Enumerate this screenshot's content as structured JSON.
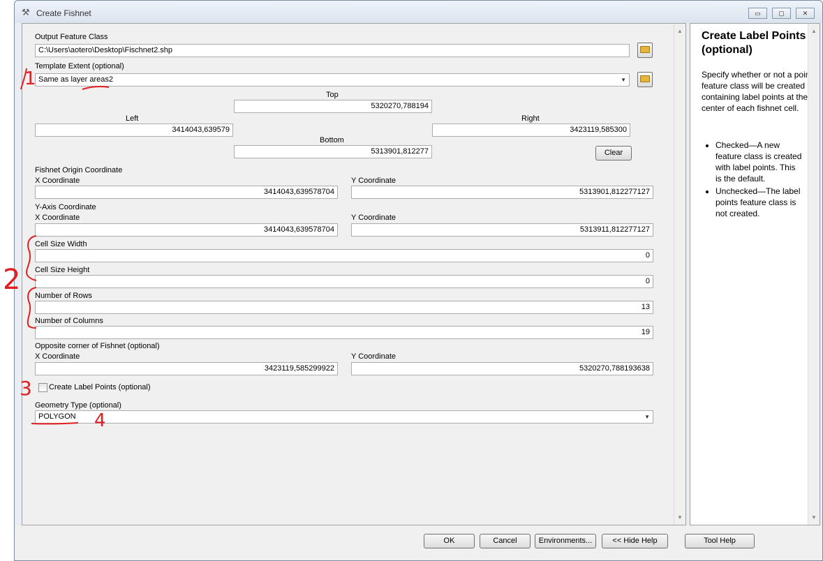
{
  "window": {
    "title": "Create Fishnet",
    "minimize": "▭",
    "maximize": "▢",
    "close": "✕"
  },
  "form": {
    "output_label": "Output Feature Class",
    "output_value": "C:\\Users\\aotero\\Desktop\\Fischnet2.shp",
    "template_label": "Template Extent (optional)",
    "template_value": "Same as layer areas2",
    "top_label": "Top",
    "top_value": "5320270,788194",
    "left_label": "Left",
    "left_value": "3414043,639579",
    "right_label": "Right",
    "right_value": "3423119,585300",
    "bottom_label": "Bottom",
    "bottom_value": "5313901,812277",
    "clear_label": "Clear",
    "origin_label": "Fishnet Origin Coordinate",
    "origin_x_label": "X Coordinate",
    "origin_x_value": "3414043,639578704",
    "origin_y_label": "Y Coordinate",
    "origin_y_value": "5313901,812277127",
    "yaxis_label": "Y-Axis Coordinate",
    "yaxis_x_label": "X Coordinate",
    "yaxis_x_value": "3414043,639578704",
    "yaxis_y_label": "Y Coordinate",
    "yaxis_y_value": "5313911,812277127",
    "cell_width_label": "Cell Size Width",
    "cell_width_value": "0",
    "cell_height_label": "Cell Size Height",
    "cell_height_value": "0",
    "rows_label": "Number of Rows",
    "rows_value": "13",
    "cols_label": "Number of Columns",
    "cols_value": "19",
    "opposite_label": "Opposite corner of Fishnet (optional)",
    "opposite_x_label": "X Coordinate",
    "opposite_x_value": "3423119,585299922",
    "opposite_y_label": "Y Coordinate",
    "opposite_y_value": "5320270,788193638",
    "label_points_label": "Create Label Points (optional)",
    "label_points_checked": false,
    "geometry_label": "Geometry Type (optional)",
    "geometry_value": "POLYGON"
  },
  "buttons": {
    "ok": "OK",
    "cancel": "Cancel",
    "environments": "Environments...",
    "hide_help": "<< Hide Help",
    "tool_help": "Tool Help"
  },
  "help": {
    "title": "Create Label Points (optional)",
    "body": "Specify whether or not a point feature class will be created containing label points at the center of each fishnet cell.",
    "items": [
      "Checked—A new feature class is created with label points. This is the default.",
      "Unchecked—The label points feature class is not created."
    ]
  },
  "annotations": {
    "n1": "1",
    "n2": "2",
    "n3": "3",
    "n4": "4",
    "color": "#e02020"
  }
}
